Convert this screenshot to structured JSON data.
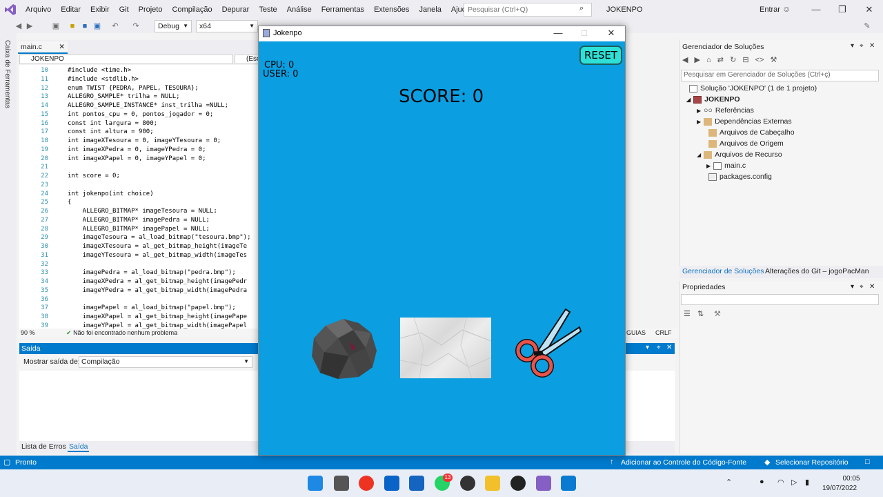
{
  "menu": [
    "Arquivo",
    "Editar",
    "Exibir",
    "Git",
    "Projeto",
    "Compilação",
    "Depurar",
    "Teste",
    "Análise",
    "Ferramentas",
    "Extensões",
    "Janela",
    "Ajuda"
  ],
  "search": {
    "placeholder": "Pesquisar (Ctrl+Q)"
  },
  "solution_name": "JOKENPO",
  "signin": "Entrar",
  "toolbar": {
    "config": "Debug",
    "platform": "x64"
  },
  "toolbox_label": "Caixa de Ferramentas",
  "editor": {
    "tab": "main.c",
    "nav_scope": "JOKENPO",
    "nav_scope2": "(Esc",
    "lines": [
      {
        "n": "10",
        "t": "#include <time.h>"
      },
      {
        "n": "11",
        "t": "#include <stdlib.h>"
      },
      {
        "n": "12",
        "t": "enum TWIST {PEDRA, PAPEL, TESOURA};"
      },
      {
        "n": "13",
        "t": "ALLEGRO_SAMPLE* trilha = NULL;"
      },
      {
        "n": "14",
        "t": "ALLEGRO_SAMPLE_INSTANCE* inst_trilha =NULL;"
      },
      {
        "n": "15",
        "t": "int pontos_cpu = 0, pontos_jogador = 0;"
      },
      {
        "n": "16",
        "t": "const int largura = 800;"
      },
      {
        "n": "17",
        "t": "const int altura = 900;"
      },
      {
        "n": "18",
        "t": "int imageXTesoura = 0, imageYTesoura = 0;"
      },
      {
        "n": "19",
        "t": "int imageXPedra = 0, imageYPedra = 0;"
      },
      {
        "n": "20",
        "t": "int imageXPapel = 0, imageYPapel = 0;"
      },
      {
        "n": "21",
        "t": ""
      },
      {
        "n": "22",
        "t": "int score = 0;"
      },
      {
        "n": "23",
        "t": ""
      },
      {
        "n": "24",
        "t": "int jokenpo(int choice)"
      },
      {
        "n": "25",
        "t": "{"
      },
      {
        "n": "26",
        "t": "    ALLEGRO_BITMAP* imageTesoura = NULL;"
      },
      {
        "n": "27",
        "t": "    ALLEGRO_BITMAP* imagePedra = NULL;"
      },
      {
        "n": "28",
        "t": "    ALLEGRO_BITMAP* imagePapel = NULL;"
      },
      {
        "n": "29",
        "t": "    imageTesoura = al_load_bitmap(\"tesoura.bmp\");"
      },
      {
        "n": "30",
        "t": "    imageXTesoura = al_get_bitmap_height(imageTe"
      },
      {
        "n": "31",
        "t": "    imageYTesoura = al_get_bitmap_width(imageTes"
      },
      {
        "n": "32",
        "t": ""
      },
      {
        "n": "33",
        "t": "    imagePedra = al_load_bitmap(\"pedra.bmp\");"
      },
      {
        "n": "34",
        "t": "    imageXPedra = al_get_bitmap_height(imagePedr"
      },
      {
        "n": "35",
        "t": "    imageYPedra = al_get_bitmap_width(imagePedra"
      },
      {
        "n": "36",
        "t": ""
      },
      {
        "n": "37",
        "t": "    imagePapel = al_load_bitmap(\"papel.bmp\");"
      },
      {
        "n": "38",
        "t": "    imageXPapel = al_get_bitmap_height(imagePape"
      },
      {
        "n": "39",
        "t": "    imageYPapel = al_get_bitmap_width(imagePapel"
      }
    ],
    "zoom": "90 %",
    "problems": "Não foi encontrado nenhum problema",
    "right_status1": "GUIAS",
    "right_status2": "CRLF"
  },
  "output": {
    "title": "Saída",
    "show_label": "Mostrar saída de:",
    "source": "Compilação"
  },
  "bottom_tabs": {
    "errors": "Lista de Erros",
    "output": "Saída"
  },
  "solution_explorer": {
    "title": "Gerenciador de Soluções",
    "search_placeholder": "Pesquisar em Gerenciador de Soluções (Ctrl+ç)",
    "items": [
      {
        "label": "Solução 'JOKENPO' (1 de 1 projeto)"
      },
      {
        "label": "JOKENPO"
      },
      {
        "label": "Referências"
      },
      {
        "label": "Dependências Externas"
      },
      {
        "label": "Arquivos de Cabeçalho"
      },
      {
        "label": "Arquivos de Origem"
      },
      {
        "label": "Arquivos de Recurso"
      },
      {
        "label": "main.c"
      },
      {
        "label": "packages.config"
      }
    ],
    "tab1": "Gerenciador de Soluções",
    "tab2": "Alterações do Git – jogoPacMan"
  },
  "properties": {
    "title": "Propriedades"
  },
  "statusbar": {
    "ready": "Pronto",
    "git": "Adicionar ao Controle do Código-Fonte",
    "repo": "Selecionar Repositório"
  },
  "taskbar": {
    "time": "00:05",
    "date": "19/07/2022",
    "whatsapp_badge": "13"
  },
  "game": {
    "title": "Jokenpo",
    "reset": "RESET",
    "cpu": "CPU: 0",
    "user": "USER: 0",
    "score": "SCORE: 0",
    "background": "#0b9ee0"
  }
}
